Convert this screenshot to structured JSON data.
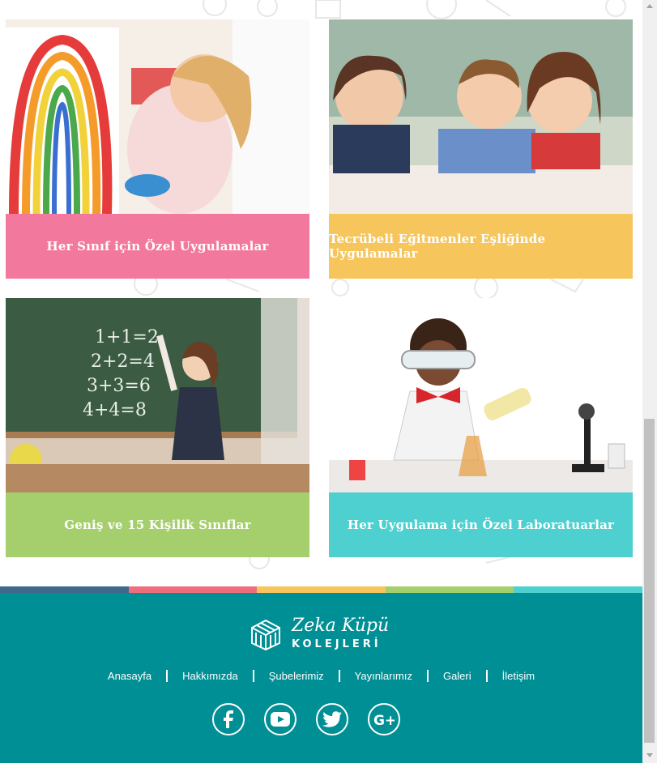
{
  "cards": [
    {
      "caption": "Her Sınıf için Özel Uygulamalar",
      "image": "child-painting-rainbow"
    },
    {
      "caption": "Tecrübeli Eğitmenler Eşliğinde Uygulamalar",
      "image": "children-lying-on-floor"
    },
    {
      "caption": "Geniş ve 15 Kişilik Sınıflar",
      "image": "girl-at-chalkboard"
    },
    {
      "caption": "Her Uygulama için Özel Laboratuarlar",
      "image": "child-scientist-lab"
    }
  ],
  "footer": {
    "logo_name": "Zeka Küpü",
    "logo_sub": "KOLEJLERİ",
    "nav": [
      "Anasayfa",
      "Hakkımızda",
      "Şubelerimiz",
      "Yayınlarımız",
      "Galeri",
      "İletişim"
    ],
    "social": [
      "facebook-icon",
      "youtube-icon",
      "twitter-icon",
      "google-plus-icon"
    ]
  },
  "colors": {
    "pink": "#f2799d",
    "yellow": "#f6c55c",
    "green": "#a4cf6c",
    "cyan": "#4dd0cf",
    "footer": "#008f95",
    "stripe": [
      "#3d6a8a",
      "#ee6e7e",
      "#f6c55c",
      "#a4cf6c",
      "#4dd0cf"
    ]
  }
}
